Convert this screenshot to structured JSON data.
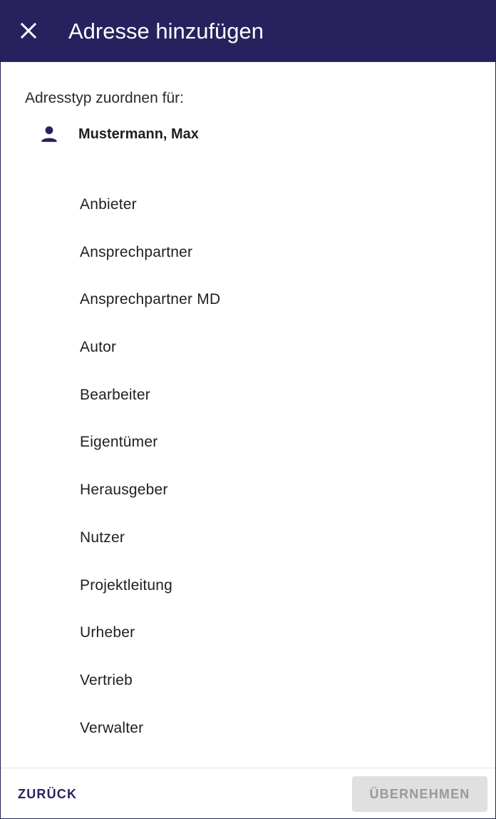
{
  "header": {
    "title": "Adresse hinzufügen",
    "close_icon": "close-icon"
  },
  "content": {
    "subtitle": "Adresstyp zuordnen für:",
    "user": {
      "icon": "person-icon",
      "name": "Mustermann, Max"
    },
    "address_types": [
      {
        "label": "Anbieter"
      },
      {
        "label": "Ansprechpartner"
      },
      {
        "label": "Ansprechpartner MD"
      },
      {
        "label": "Autor"
      },
      {
        "label": "Bearbeiter"
      },
      {
        "label": "Eigentümer"
      },
      {
        "label": "Herausgeber"
      },
      {
        "label": "Nutzer"
      },
      {
        "label": "Projektleitung"
      },
      {
        "label": "Urheber"
      },
      {
        "label": "Vertrieb"
      },
      {
        "label": "Verwalter"
      }
    ]
  },
  "footer": {
    "back_label": "ZURÜCK",
    "apply_label": "ÜBERNEHMEN",
    "apply_disabled": true
  },
  "colors": {
    "header_bg": "#27225e",
    "primary_text": "#27225e",
    "disabled_bg": "#e0e0e0",
    "disabled_text": "#9a9a9a"
  }
}
